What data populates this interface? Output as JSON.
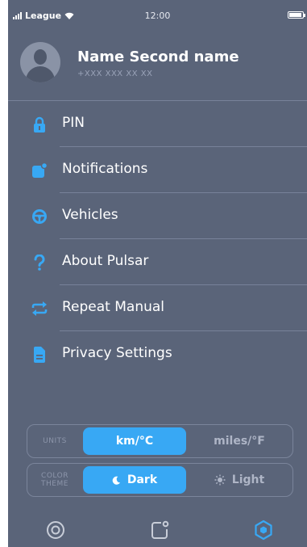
{
  "status_bar": {
    "carrier": "League",
    "time": "12:00"
  },
  "profile": {
    "name": "Name Second name",
    "phone": "+XXX XXX XX XX"
  },
  "menu": [
    {
      "label": "PIN",
      "icon": "lock-icon"
    },
    {
      "label": "Notifications",
      "icon": "notification-icon"
    },
    {
      "label": "Vehicles",
      "icon": "steering-wheel-icon"
    },
    {
      "label": "About Pulsar",
      "icon": "question-icon"
    },
    {
      "label": "Repeat Manual",
      "icon": "repeat-icon"
    },
    {
      "label": "Privacy Settings",
      "icon": "document-icon"
    }
  ],
  "units": {
    "label": "UNITS",
    "options": [
      "km/°C",
      "miles/°F"
    ],
    "selected": "km/°C"
  },
  "theme": {
    "label_line1": "COLOR",
    "label_line2": "THEME",
    "options": [
      "Dark",
      "Light"
    ],
    "selected": "Dark"
  },
  "tabbar": {
    "items": [
      "target-icon",
      "notification-icon",
      "hexagon-icon"
    ],
    "active": "hexagon-icon"
  },
  "colors": {
    "background": "#5a6479",
    "accent": "#38a8f4",
    "divider": "#78829a"
  }
}
